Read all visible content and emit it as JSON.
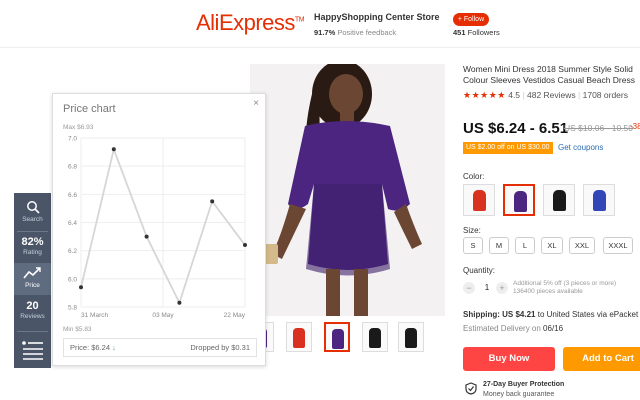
{
  "header": {
    "logo": "AliExpress",
    "store_name": "HappyShopping Center Store",
    "feedback_pct": "91.7%",
    "feedback_label": "Positive feedback",
    "follow_label": "+ Follow",
    "followers_count": "451",
    "followers_label": "Followers"
  },
  "product": {
    "title": "Women Mini Dress 2018 Summer Style Solid Colour Sleeves Vestidos Casual Beach Dress",
    "stars": "★★★★★",
    "rating": "4.5",
    "reviews": "482 Reviews",
    "orders": "1708 orders",
    "price": "US $6.24 - 6.51",
    "old_price": "US $10.06 - 10.50",
    "discount": "-38%",
    "coupon_badge": "US $2.00 off on US $30.00",
    "coupon_link": "Get coupons",
    "color_label": "Color:",
    "colors": [
      "#d9301f",
      "#4b2580",
      "#1a1a1a",
      "#3346b8"
    ],
    "size_label": "Size:",
    "sizes": [
      "S",
      "M",
      "L",
      "XL",
      "XXL",
      "XXXL"
    ],
    "quantity_label": "Quantity:",
    "quantity": "1",
    "qty_note": "Additional 5% off (3 pieces or more) 136400 pieces available",
    "shipping_prefix": "Shipping:",
    "shipping_price": "US $4.21",
    "shipping_rest": "to United States via ePacket",
    "delivery_label": "Estimated Delivery on",
    "delivery_date": "06/16",
    "buy_now": "Buy Now",
    "add_to_cart": "Add to Cart",
    "protection_title": "27-Day Buyer Protection",
    "protection_sub": "Money back guarantee",
    "thumb_colors": [
      "#4b2580",
      "#d9301f",
      "#4b2580",
      "#1a1a1a",
      "#1a1a1a"
    ]
  },
  "extension": {
    "search_label": "Search",
    "rating_value": "82%",
    "rating_label": "Rating",
    "price_label": "Price",
    "reviews_value": "20",
    "reviews_label": "Reviews"
  },
  "price_chart": {
    "title": "Price chart",
    "close": "×",
    "max_label": "Max $6.93",
    "min_label": "Min $5.83",
    "footer_price": "Price: $6.24",
    "footer_arrow": "↓",
    "footer_drop": "Dropped by $0.31"
  },
  "chart_data": {
    "type": "line",
    "title": "Price chart",
    "x": [
      "31 March",
      "",
      "03 May",
      "",
      "",
      "22 May"
    ],
    "x_ticks": [
      "31 March",
      "03 May",
      "22 May"
    ],
    "y_ticks": [
      "7.0",
      "6.8",
      "6.6",
      "6.4",
      "6.2",
      "6.0",
      "5.8"
    ],
    "ylim": [
      5.8,
      7.0
    ],
    "series": [
      {
        "values": [
          5.94,
          6.92,
          6.3,
          5.83,
          6.55,
          6.24
        ]
      }
    ],
    "grid": true
  }
}
